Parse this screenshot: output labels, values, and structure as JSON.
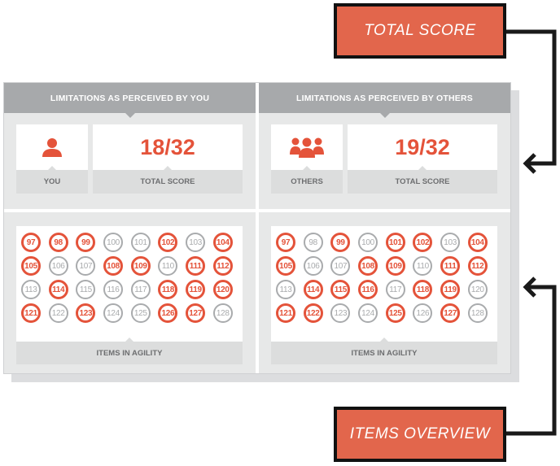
{
  "colors": {
    "accent": "#e4533a",
    "inactive": "#a9abad",
    "header_bg": "#a7a9ab",
    "callout_bg": "#e2664c"
  },
  "callouts": {
    "total_score": "TOTAL SCORE",
    "items_overview": "ITEMS OVERVIEW"
  },
  "panels": [
    {
      "header": "LIMITATIONS AS PERCEIVED BY YOU",
      "who_icon": "person-icon",
      "who_label": "YOU",
      "score": "18/32",
      "score_label": "TOTAL SCORE",
      "items_label": "ITEMS IN AGILITY",
      "items": [
        {
          "n": "97",
          "on": true
        },
        {
          "n": "98",
          "on": true
        },
        {
          "n": "99",
          "on": true
        },
        {
          "n": "100",
          "on": false
        },
        {
          "n": "101",
          "on": false
        },
        {
          "n": "102",
          "on": true
        },
        {
          "n": "103",
          "on": false
        },
        {
          "n": "104",
          "on": true
        },
        {
          "n": "105",
          "on": true
        },
        {
          "n": "106",
          "on": false
        },
        {
          "n": "107",
          "on": false
        },
        {
          "n": "108",
          "on": true
        },
        {
          "n": "109",
          "on": true
        },
        {
          "n": "110",
          "on": false
        },
        {
          "n": "111",
          "on": true
        },
        {
          "n": "112",
          "on": true
        },
        {
          "n": "113",
          "on": false
        },
        {
          "n": "114",
          "on": true
        },
        {
          "n": "115",
          "on": false
        },
        {
          "n": "116",
          "on": false
        },
        {
          "n": "117",
          "on": false
        },
        {
          "n": "118",
          "on": true
        },
        {
          "n": "119",
          "on": true
        },
        {
          "n": "120",
          "on": true
        },
        {
          "n": "121",
          "on": true
        },
        {
          "n": "122",
          "on": false
        },
        {
          "n": "123",
          "on": true
        },
        {
          "n": "124",
          "on": false
        },
        {
          "n": "125",
          "on": false
        },
        {
          "n": "126",
          "on": true
        },
        {
          "n": "127",
          "on": true
        },
        {
          "n": "128",
          "on": false
        }
      ]
    },
    {
      "header": "LIMITATIONS AS PERCEIVED BY OTHERS",
      "who_icon": "group-icon",
      "who_label": "OTHERS",
      "score": "19/32",
      "score_label": "TOTAL SCORE",
      "items_label": "ITEMS IN AGILITY",
      "items": [
        {
          "n": "97",
          "on": true
        },
        {
          "n": "98",
          "on": false
        },
        {
          "n": "99",
          "on": true
        },
        {
          "n": "100",
          "on": false
        },
        {
          "n": "101",
          "on": true
        },
        {
          "n": "102",
          "on": true
        },
        {
          "n": "103",
          "on": false
        },
        {
          "n": "104",
          "on": true
        },
        {
          "n": "105",
          "on": true
        },
        {
          "n": "106",
          "on": false
        },
        {
          "n": "107",
          "on": false
        },
        {
          "n": "108",
          "on": true
        },
        {
          "n": "109",
          "on": true
        },
        {
          "n": "110",
          "on": false
        },
        {
          "n": "111",
          "on": true
        },
        {
          "n": "112",
          "on": true
        },
        {
          "n": "113",
          "on": false
        },
        {
          "n": "114",
          "on": true
        },
        {
          "n": "115",
          "on": true
        },
        {
          "n": "116",
          "on": true
        },
        {
          "n": "117",
          "on": false
        },
        {
          "n": "118",
          "on": true
        },
        {
          "n": "119",
          "on": true
        },
        {
          "n": "120",
          "on": false
        },
        {
          "n": "121",
          "on": true
        },
        {
          "n": "122",
          "on": true
        },
        {
          "n": "123",
          "on": false
        },
        {
          "n": "124",
          "on": false
        },
        {
          "n": "125",
          "on": true
        },
        {
          "n": "126",
          "on": false
        },
        {
          "n": "127",
          "on": true
        },
        {
          "n": "128",
          "on": false
        }
      ]
    }
  ]
}
